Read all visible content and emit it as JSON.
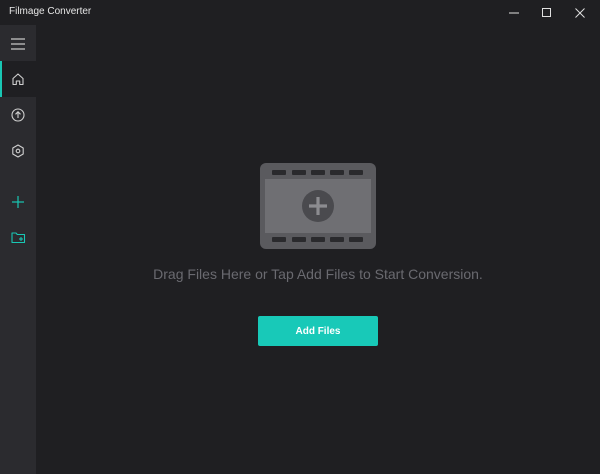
{
  "window": {
    "title": "Filmage Converter"
  },
  "sidebar": {
    "items": [
      {
        "icon": "menu-icon"
      },
      {
        "icon": "home-icon",
        "active": true
      },
      {
        "icon": "upload-icon"
      },
      {
        "icon": "settings-icon"
      },
      {
        "icon": "add-icon"
      },
      {
        "icon": "add-folder-icon"
      }
    ]
  },
  "main": {
    "drop_text": "Drag Files Here or Tap Add Files to Start Conversion.",
    "add_button_label": "Add Files"
  },
  "colors": {
    "accent": "#18c9b8",
    "background": "#1f1f22",
    "sidebar": "#2b2b2f",
    "muted_text": "#6a6a70"
  }
}
